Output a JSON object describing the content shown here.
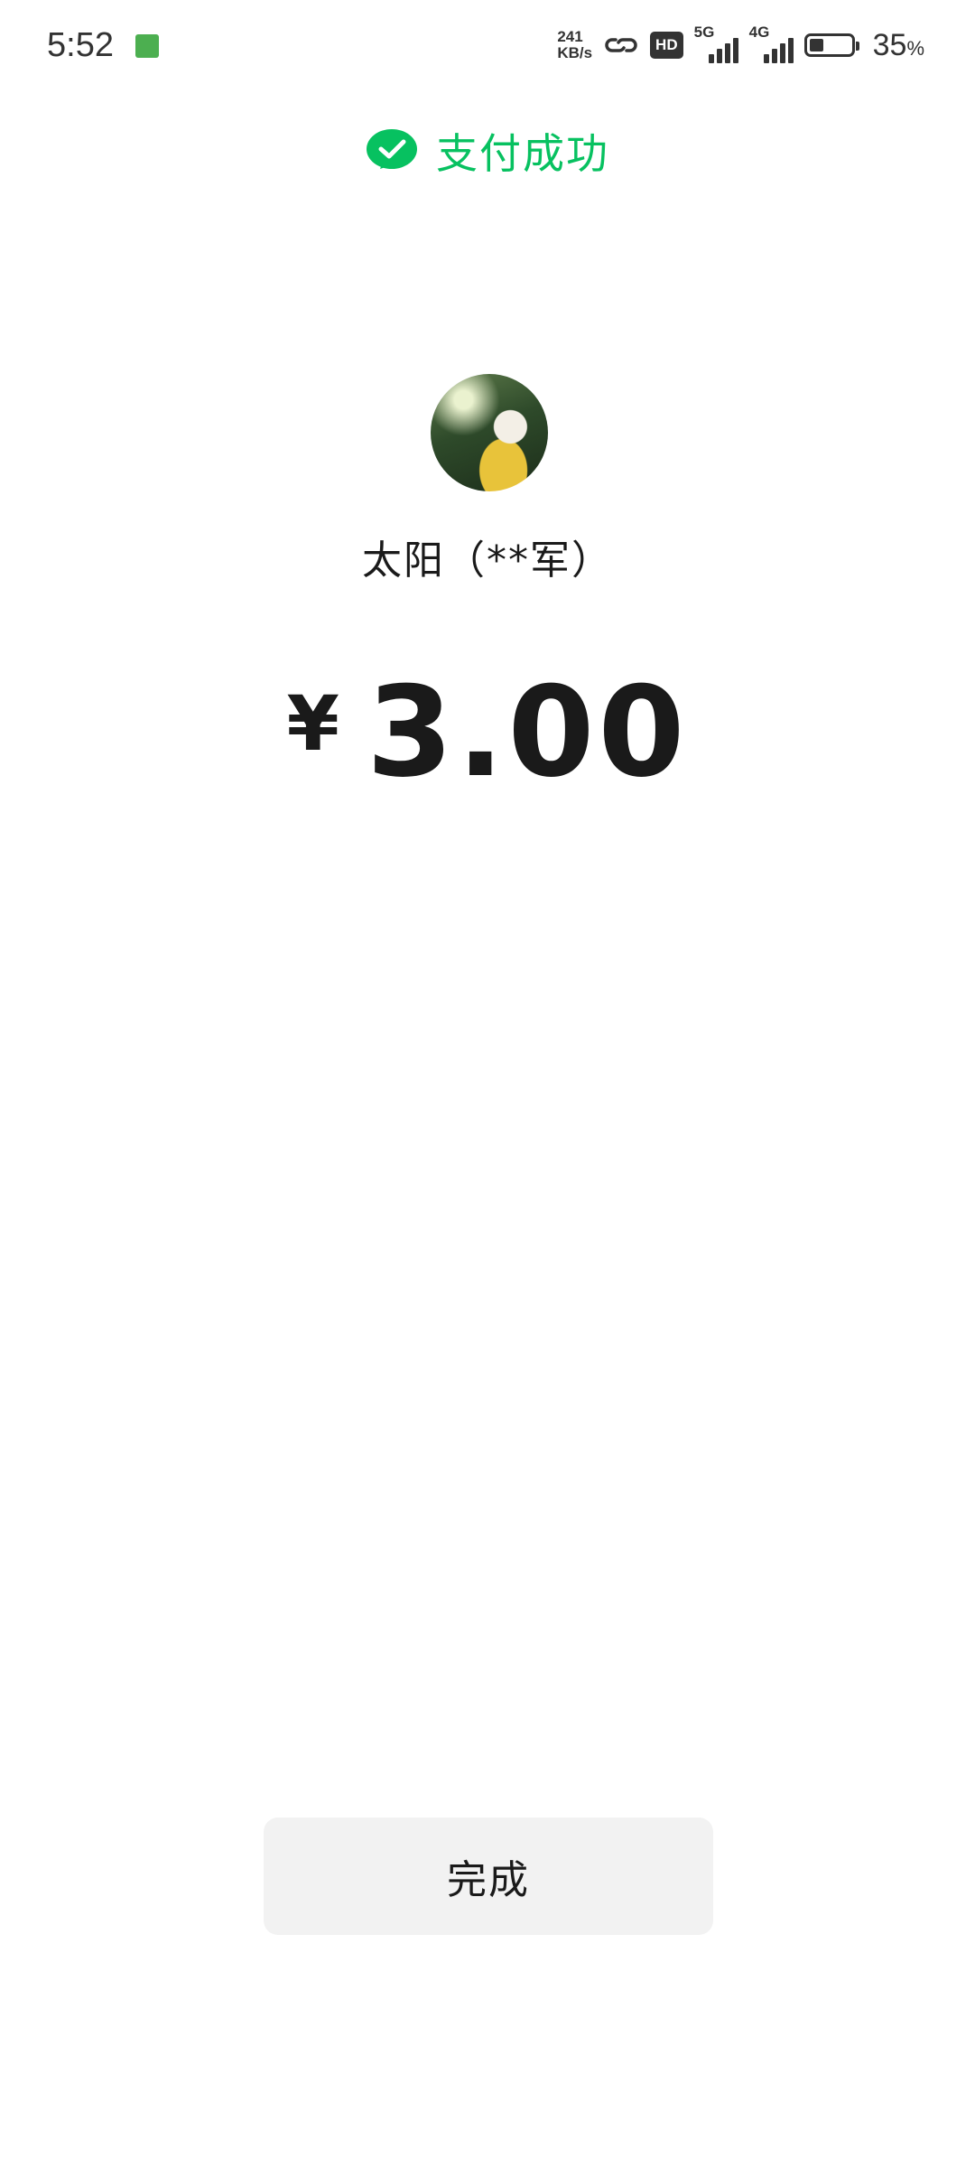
{
  "status_bar": {
    "time": "5:52",
    "net_speed_value": "241",
    "net_speed_unit": "KB/s",
    "hd_label": "HD",
    "network_1": "5G",
    "network_2": "4G",
    "battery_percent": "35",
    "battery_percent_sign": "%",
    "battery_level": 0.35
  },
  "header": {
    "title": "支付成功",
    "brand_color": "#07c160"
  },
  "payee": {
    "name": "太阳（**军）"
  },
  "payment": {
    "currency_symbol": "¥",
    "amount": "3.00"
  },
  "actions": {
    "done_label": "完成"
  }
}
